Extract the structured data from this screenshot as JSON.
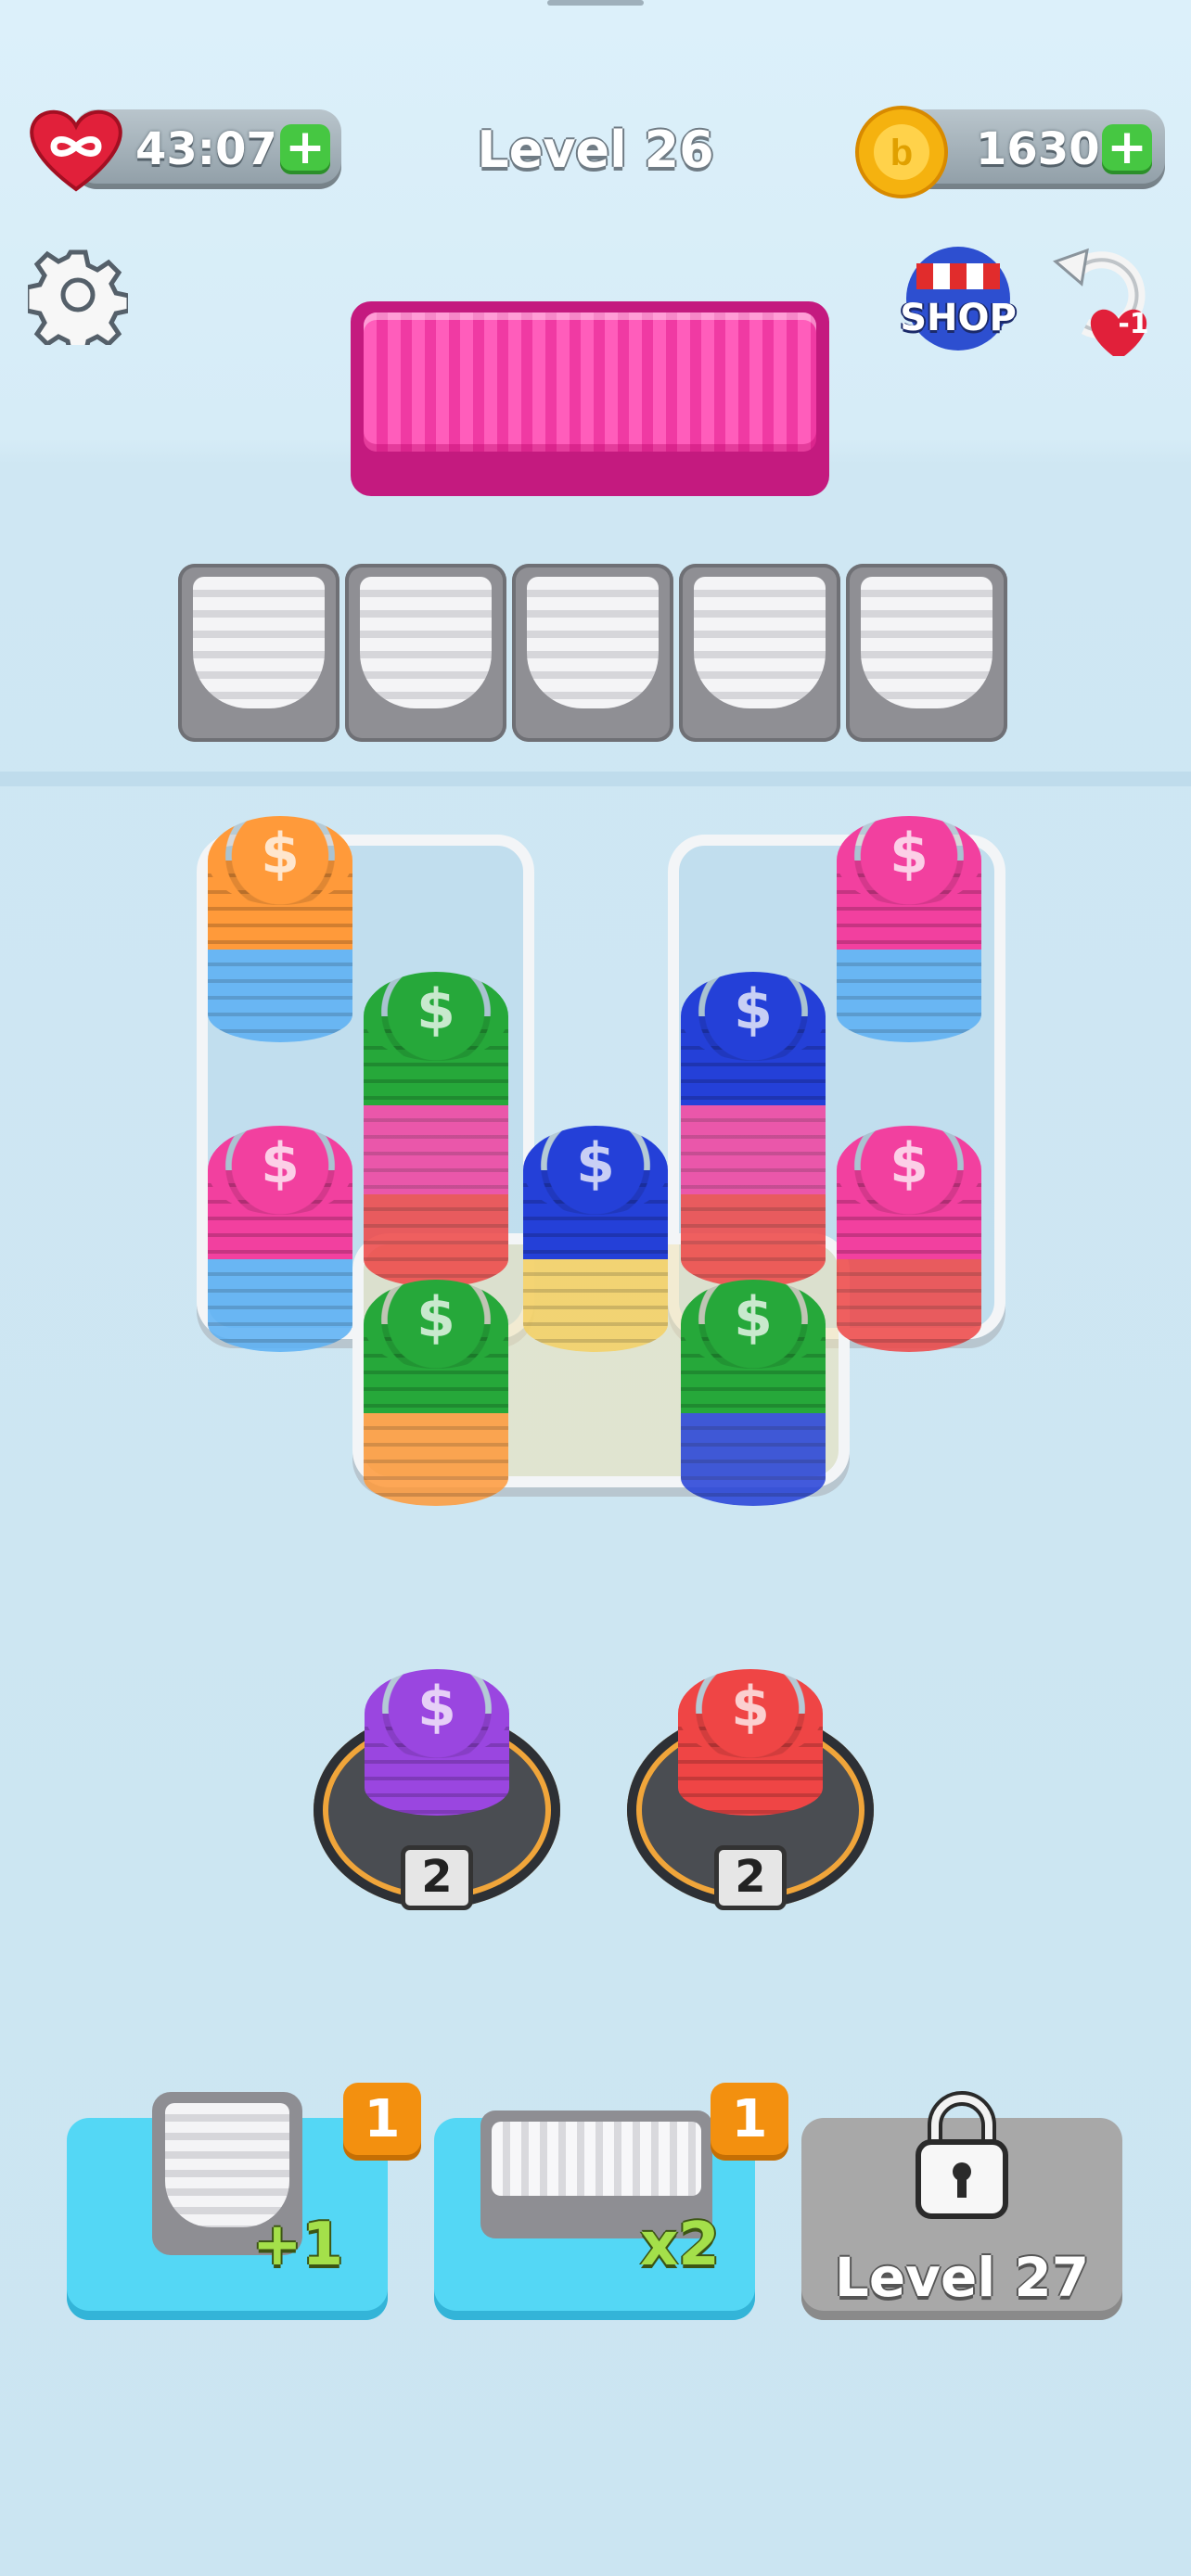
{
  "hud": {
    "lives_timer": "43:07",
    "coins": "1630",
    "level_title": "Level 26",
    "shop_label": "SHOP",
    "undo_badge": "-1"
  },
  "icons": {
    "lives": "infinite-heart-icon",
    "coins": "gold-coin-icon",
    "settings": "gear-icon",
    "shop": "shop-awning-icon",
    "undo": "undo-arrow-icon",
    "lock": "padlock-icon"
  },
  "colors": {
    "orange": "#ff9a3a",
    "green": "#26a83a",
    "blue": "#2440d8",
    "pink": "#f2409f",
    "red": "#ef4545",
    "purple": "#9a46e0",
    "yellow": "#f5d163",
    "lightblue": "#5ab0f5"
  },
  "board": {
    "slot_count": 5
  },
  "spawners": [
    {
      "color": "purple",
      "count": "2"
    },
    {
      "color": "red",
      "count": "2"
    }
  ],
  "boosters": [
    {
      "label": "+1",
      "count": "1"
    },
    {
      "label": "x2",
      "count": "1"
    }
  ],
  "locked_booster": {
    "label": "Level 27"
  }
}
